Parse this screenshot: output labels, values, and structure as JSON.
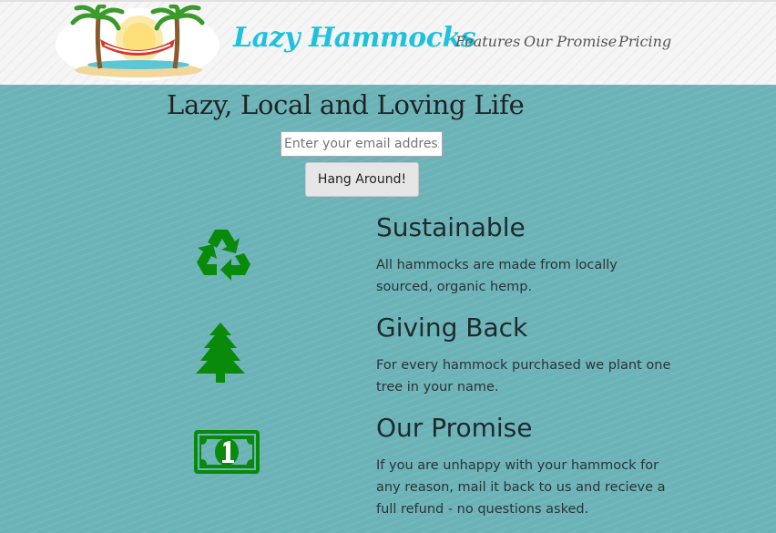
{
  "header": {
    "brand": "Lazy Hammocks",
    "logo_icon": "hammock-palm-trees-logo",
    "nav": [
      {
        "label": "Features"
      },
      {
        "label": "Our Promise"
      },
      {
        "label": "Pricing"
      }
    ]
  },
  "hero": {
    "title": "Lazy, Local and Loving Life",
    "email_placeholder": "Enter your email address",
    "cta_label": "Hang Around!"
  },
  "features": [
    {
      "icon": "recycle-icon",
      "title": "Sustainable",
      "description": "All hammocks are made from locally sourced, organic hemp."
    },
    {
      "icon": "tree-icon",
      "title": "Giving Back",
      "description": "For every hammock purchased we plant one tree in your name."
    },
    {
      "icon": "money-bill-icon",
      "title": "Our Promise",
      "description": "If you are unhappy with your hammock for any reason, mail it back to us and recieve a full refund - no questions asked."
    }
  ],
  "colors": {
    "background": "#6bb3b7",
    "header_background": "#f5f5f5",
    "brand": "#1fc2de",
    "icon_green": "#0a8a0a"
  }
}
